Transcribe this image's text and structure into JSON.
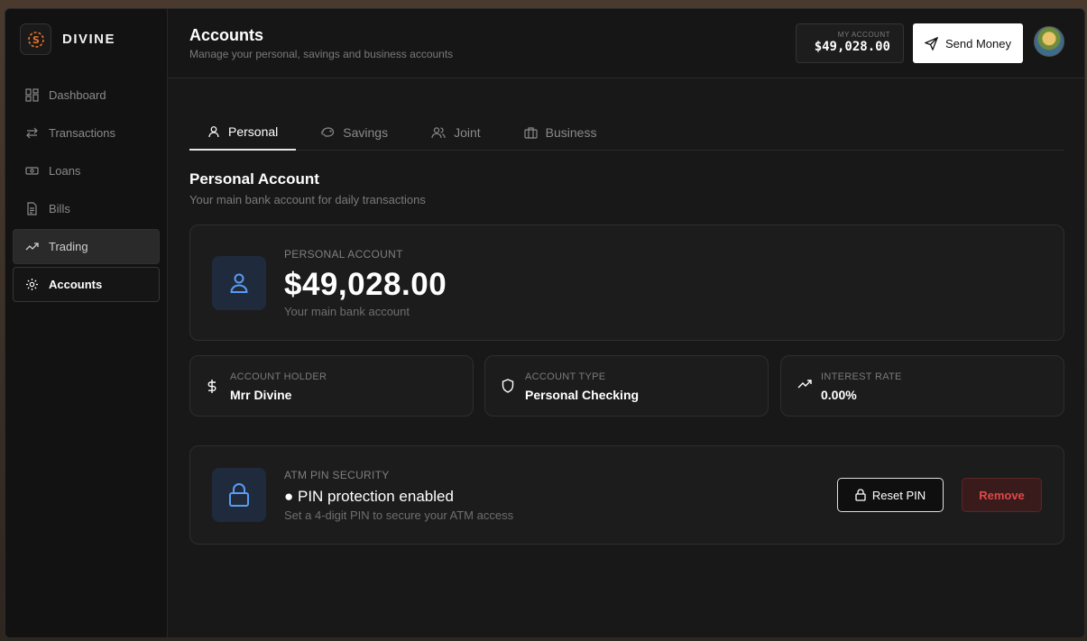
{
  "brand": {
    "name": "DIVINE",
    "logo_icon": "s-logo-icon",
    "accent": "#e8702a"
  },
  "sidebar": {
    "items": [
      {
        "label": "Dashboard",
        "icon": "grid-icon",
        "state": "normal"
      },
      {
        "label": "Transactions",
        "icon": "arrows-swap-icon",
        "state": "normal"
      },
      {
        "label": "Loans",
        "icon": "banknote-icon",
        "state": "normal"
      },
      {
        "label": "Bills",
        "icon": "document-icon",
        "state": "normal"
      },
      {
        "label": "Trading",
        "icon": "trend-up-icon",
        "state": "hover"
      },
      {
        "label": "Accounts",
        "icon": "gear-icon",
        "state": "active"
      }
    ]
  },
  "header": {
    "title": "Accounts",
    "subtitle": "Manage your personal, savings and business accounts",
    "my_account_label": "MY ACCOUNT",
    "my_account_value": "$49,028.00",
    "send_money_label": "Send Money"
  },
  "tabs": [
    {
      "label": "Personal",
      "icon": "user-icon",
      "active": true
    },
    {
      "label": "Savings",
      "icon": "piggy-bank-icon",
      "active": false
    },
    {
      "label": "Joint",
      "icon": "users-icon",
      "active": false
    },
    {
      "label": "Business",
      "icon": "briefcase-icon",
      "active": false
    }
  ],
  "section": {
    "title": "Personal Account",
    "subtitle": "Your main bank account for daily transactions"
  },
  "account_card": {
    "label": "PERSONAL ACCOUNT",
    "amount": "$49,028.00",
    "description": "Your main bank account"
  },
  "details": [
    {
      "label": "ACCOUNT HOLDER",
      "value": "Mrr Divine",
      "icon": "dollar-icon"
    },
    {
      "label": "ACCOUNT TYPE",
      "value": "Personal Checking",
      "icon": "shield-icon"
    },
    {
      "label": "INTEREST RATE",
      "value": "0.00%",
      "icon": "trend-up-icon"
    }
  ],
  "pin": {
    "label": "ATM PIN SECURITY",
    "status": "● PIN protection enabled",
    "description": "Set a 4-digit PIN to secure your ATM access",
    "reset_label": "Reset PIN",
    "remove_label": "Remove"
  },
  "colors": {
    "tile_bg": "#1f2a3d",
    "tile_icon": "#5b9bf0",
    "danger": "#e04848"
  }
}
